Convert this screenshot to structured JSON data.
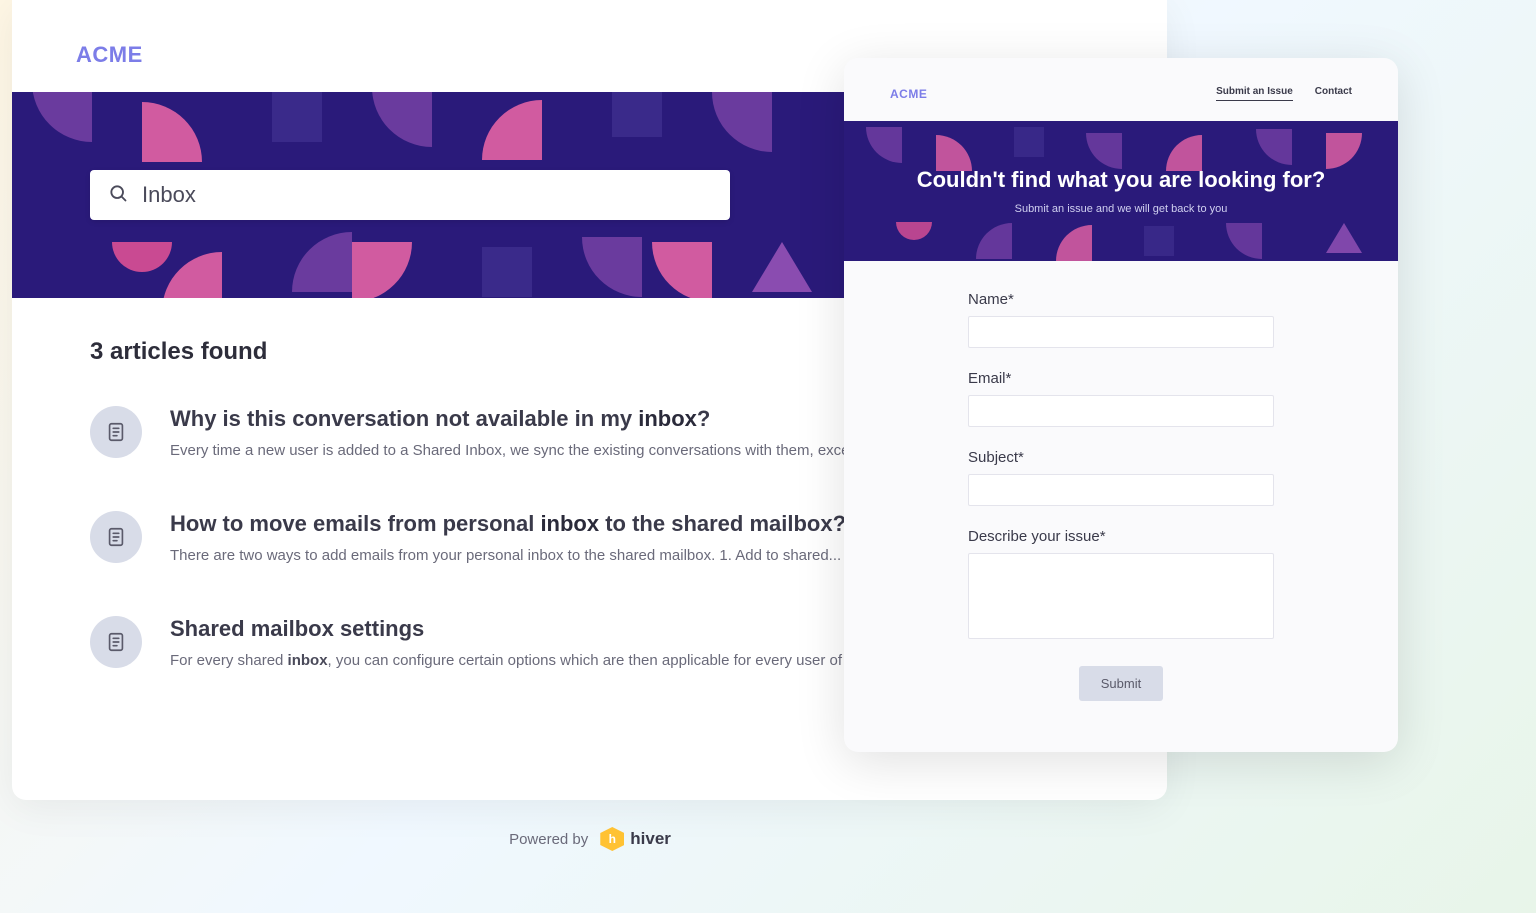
{
  "brand": "ACME",
  "search": {
    "value": "Inbox"
  },
  "results": {
    "count_label": "3 articles found",
    "articles": [
      {
        "title_prefix": "Why is this conversation not available in my ",
        "title_bold": "inbox",
        "title_suffix": "?",
        "excerpt": "Every time a new user is added to a Shared Inbox, we sync the existing conversations with them, except..."
      },
      {
        "title_prefix": "How to move emails from personal ",
        "title_bold": "inbox",
        "title_suffix": " to the shared mailbox?",
        "excerpt": "There are two ways to add emails from your personal inbox to the shared mailbox. 1. Add to shared..."
      },
      {
        "title_prefix": "Shared mailbox settings",
        "title_bold": "",
        "title_suffix": "",
        "excerpt_prefix": "For every shared ",
        "excerpt_bold": "inbox",
        "excerpt_suffix": ", you can configure certain options which are then applicable for every user of th ..."
      }
    ]
  },
  "issuePanel": {
    "brand": "ACME",
    "nav": {
      "submit": "Submit an Issue",
      "contact": "Contact"
    },
    "hero": {
      "title": "Couldn't find what you are looking for?",
      "subtitle": "Submit an issue and we will get back to you"
    },
    "form": {
      "name_label": "Name*",
      "email_label": "Email*",
      "subject_label": "Subject*",
      "describe_label": "Describe your issue*",
      "submit_label": "Submit"
    }
  },
  "footer": {
    "powered_by": "Powered by",
    "vendor": "hiver"
  }
}
